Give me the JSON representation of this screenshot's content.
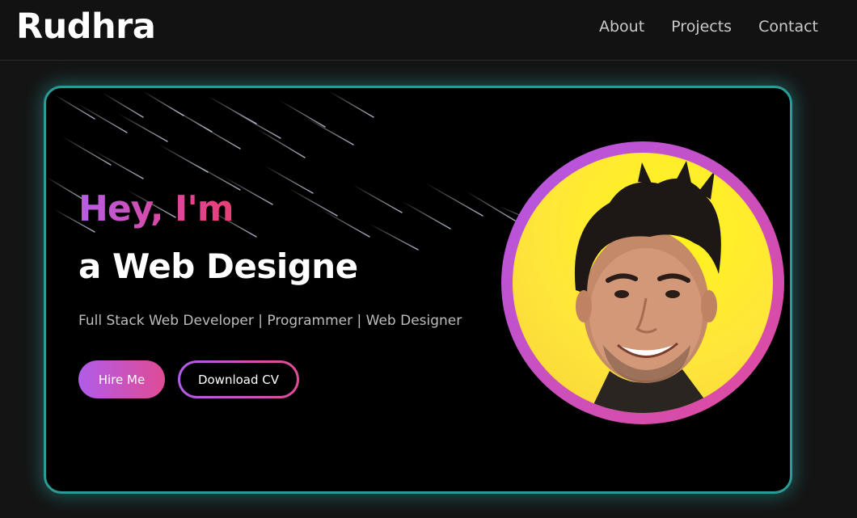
{
  "nav": {
    "logo": "Rudhra",
    "links": [
      "About",
      "Projects",
      "Contact"
    ]
  },
  "hero": {
    "greeting": "Hey, I'm",
    "role": "a Web Designe",
    "subtitle": "Full Stack Web Developer | Programmer | Web Designer",
    "hire_label": "Hire Me",
    "cv_label": "Download CV"
  },
  "colors": {
    "background": "#141414",
    "card_border": "#2a9c98",
    "gradient_start": "#b45ee8",
    "gradient_end": "#ec3d75",
    "avatar_background": "#ffe63a"
  }
}
